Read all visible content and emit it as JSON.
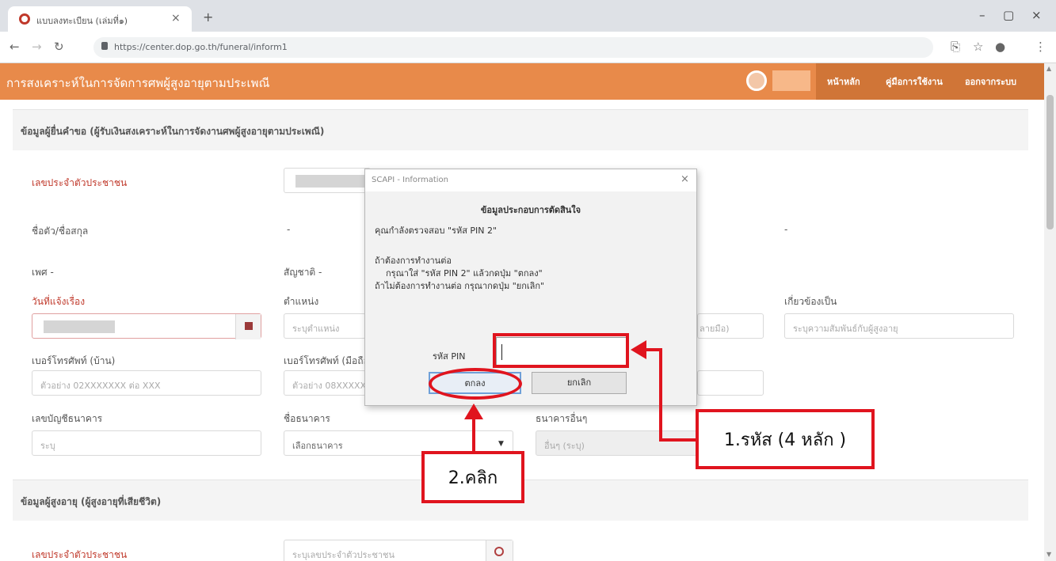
{
  "browser": {
    "tab_title": "แบบลงทะเบียน (เล่มที่๑)",
    "tab_close": "×",
    "new_tab": "+",
    "url": "https://center.dop.go.th/funeral/inform1",
    "minimize": "–",
    "maximize": "▢",
    "close": "×"
  },
  "app": {
    "title": "การสงเคราะห์ในการจัดการศพผู้สูงอายุตามประเพณี",
    "menu": [
      "หน้าหลัก",
      "คู่มือการใช้งาน",
      "ออกจากระบบ"
    ]
  },
  "section1": {
    "title": "ข้อมูลผู้ยื่นคำขอ (ผู้รับเงินสงเคราะห์ในการจัดงานศพผู้สูงอายุตามประเพณี)"
  },
  "form": {
    "id_label": "เลขประจำตัวประชาชน",
    "name_label": "ชื่อตัว/ชื่อสกุล",
    "name_dash": "-",
    "name_dash2": "-",
    "gender_label": "เพศ -",
    "nationality_label": "สัญชาติ -",
    "birthdate_label": "วันที่แจ้งเรื่อง",
    "position_label": "ตำแหน่ง",
    "position_placeholder": "ระบุตำแหน่ง",
    "relation_label": "เกี่ยวข้องเป็น",
    "relation_placeholder": "ระบุความสัมพันธ์กับผู้สูงอายุ",
    "partial_placeholder": "ลายมือ)",
    "phone_home_label": "เบอร์โทรศัพท์ (บ้าน)",
    "phone_home_placeholder": "ตัวอย่าง 02XXXXXXX ต่อ XXX",
    "phone_mobile_label": "เบอร์โทรศัพท์ (มือถือ)",
    "phone_mobile_placeholder": "ตัวอย่าง 08XXXXXXXX",
    "bank_account_label": "เลขบัญชีธนาคาร",
    "bank_account_placeholder": "ระบุ",
    "bank_name_label": "ชื่อธนาคาร",
    "bank_name_value": "เลือกธนาคาร",
    "bank_other_label": "ธนาคารอื่นๆ",
    "bank_other_placeholder": "อื่นๆ (ระบุ)"
  },
  "section2": {
    "title": "ข้อมูลผู้สูงอายุ (ผู้สูงอายุที่เสียชีวิต)",
    "id_label": "เลขประจำตัวประชาชน",
    "id_placeholder": "ระบุเลขประจำตัวประชาชน"
  },
  "dialog": {
    "title": "SCAPI - Information",
    "close": "×",
    "heading": "ข้อมูลประกอบการตัดสินใจ",
    "line1": "คุณกำลังตรวจสอบ \"รหัส PIN 2\"",
    "line2": "ถ้าต้องการทำงานต่อ",
    "line3": "กรุณาใส่ \"รหัส PIN 2\" แล้วกดปุ่ม \"ตกลง\"",
    "line4": "ถ้าไม่ต้องการทำงานต่อ กรุณากดปุ่ม \"ยกเลิก\"",
    "pin_label": "รหัส PIN",
    "ok": "ตกลง",
    "cancel": "ยกเลิก"
  },
  "annotations": {
    "step1": "1.รหัส (4 หลัก )",
    "step2": "2.คลิก"
  },
  "colors": {
    "header": "#e88a4a",
    "annotation": "#e0141e",
    "required_label": "#c0392b"
  }
}
